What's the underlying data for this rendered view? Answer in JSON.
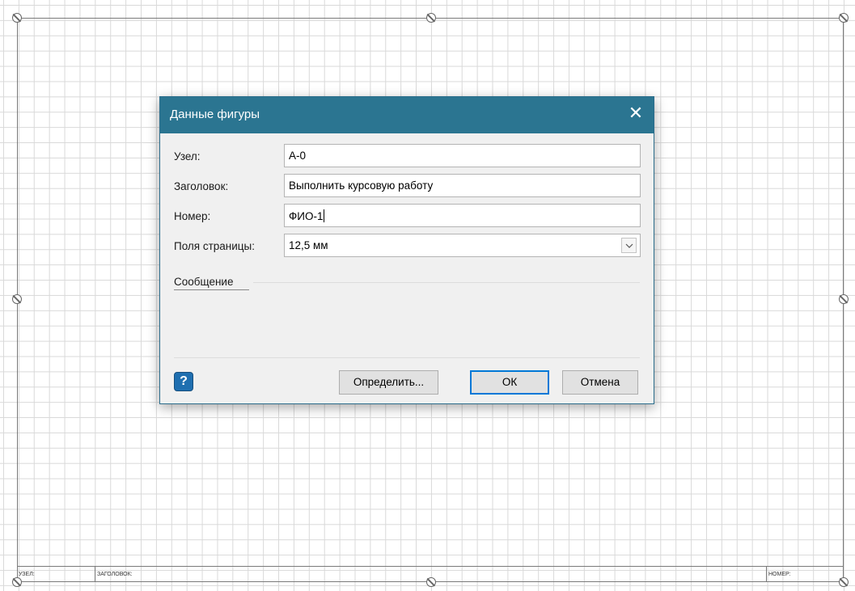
{
  "dialog": {
    "title": "Данные фигуры",
    "close_glyph": "✕",
    "fields": {
      "node": {
        "label": "Узел:",
        "value": "А-0"
      },
      "heading": {
        "label": "Заголовок:",
        "value": "Выполнить курсовую работу"
      },
      "number": {
        "label": "Номер:",
        "value": "ФИО-1"
      },
      "margins": {
        "label": "Поля страницы:",
        "value": "12,5 мм"
      }
    },
    "section_label": "Сообщение",
    "help_glyph": "?",
    "buttons": {
      "define": "Определить...",
      "ok": "ОК",
      "cancel": "Отмена"
    }
  },
  "title_block": {
    "node": "УЗЕЛ:",
    "heading": "ЗАГОЛОВОК:",
    "number": "НОМЕР:"
  },
  "icons": [
    "close-icon",
    "chevron-down-icon",
    "help-icon",
    "resize-handle-icon"
  ],
  "colors": {
    "titlebar": "#2b7591",
    "accent": "#0078d7",
    "help": "#1f6fb0"
  }
}
